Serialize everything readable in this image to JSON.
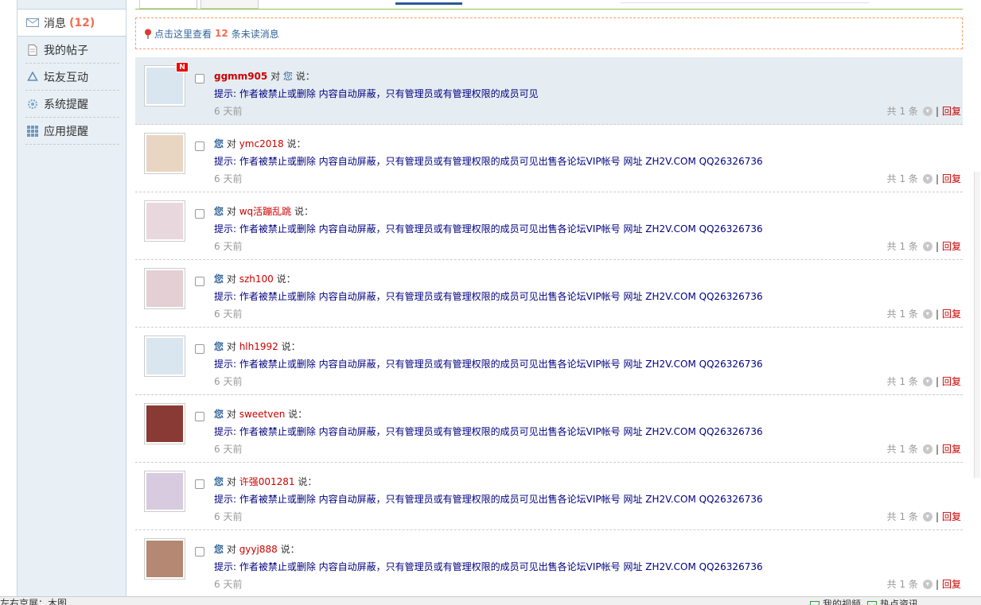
{
  "sidebar": {
    "items": [
      {
        "label": "消息",
        "count": "(12)",
        "icon": "envelope-icon"
      },
      {
        "label": "我的帖子",
        "icon": "document-icon"
      },
      {
        "label": "坛友互动",
        "icon": "recycle-icon"
      },
      {
        "label": "系统提醒",
        "icon": "gear-icon"
      },
      {
        "label": "应用提醒",
        "icon": "grid-icon"
      }
    ]
  },
  "notice": {
    "prefix": "点击这里查看",
    "count": "12",
    "suffix": "条未读消息",
    "icon": "pin-icon"
  },
  "messages": [
    {
      "sender": "ggmm905",
      "mid": "对",
      "target": "您",
      "verb": "说：",
      "content": "提示: 作者被禁止或删除 内容自动屏蔽，只有管理员或有管理权限的成员可见",
      "time": "6 天前",
      "count": "共 1 条",
      "reply": "回复",
      "new_badge": "N",
      "avatar_color": "#d9e6f0"
    },
    {
      "sender": "您",
      "mid": "对",
      "target": "ymc2018",
      "verb": "说：",
      "content": "提示: 作者被禁止或删除 内容自动屏蔽，只有管理员或有管理权限的成员可见出售各论坛VIP帐号 网址 ZH2V.COM QQ26326736",
      "time": "6 天前",
      "count": "共 1 条",
      "reply": "回复",
      "avatar_color": "#e9d6c2"
    },
    {
      "sender": "您",
      "mid": "对",
      "target": "wq活蹦乱跳",
      "verb": "说：",
      "content": "提示: 作者被禁止或删除 内容自动屏蔽，只有管理员或有管理权限的成员可见出售各论坛VIP帐号 网址 ZH2V.COM QQ26326736",
      "time": "6 天前",
      "count": "共 1 条",
      "reply": "回复",
      "avatar_color": "#e8d8de"
    },
    {
      "sender": "您",
      "mid": "对",
      "target": "szh100",
      "verb": "说：",
      "content": "提示: 作者被禁止或删除 内容自动屏蔽，只有管理员或有管理权限的成员可见出售各论坛VIP帐号 网址 ZH2V.COM QQ26326736",
      "time": "6 天前",
      "count": "共 1 条",
      "reply": "回复",
      "avatar_color": "#e3cfd4"
    },
    {
      "sender": "您",
      "mid": "对",
      "target": "hlh1992",
      "verb": "说：",
      "content": "提示: 作者被禁止或删除 内容自动屏蔽，只有管理员或有管理权限的成员可见出售各论坛VIP帐号 网址 ZH2V.COM QQ26326736",
      "time": "6 天前",
      "count": "共 1 条",
      "reply": "回复",
      "avatar_color": "#d9e6f0"
    },
    {
      "sender": "您",
      "mid": "对",
      "target": "sweetven",
      "verb": "说：",
      "content": "提示: 作者被禁止或删除 内容自动屏蔽，只有管理员或有管理权限的成员可见出售各论坛VIP帐号 网址 ZH2V.COM QQ26326736",
      "time": "6 天前",
      "count": "共 1 条",
      "reply": "回复",
      "avatar_color": "#8a3a34"
    },
    {
      "sender": "您",
      "mid": "对",
      "target": "许强001281",
      "verb": "说：",
      "content": "提示: 作者被禁止或删除 内容自动屏蔽，只有管理员或有管理权限的成员可见出售各论坛VIP帐号 网址 ZH2V.COM QQ26326736",
      "time": "6 天前",
      "count": "共 1 条",
      "reply": "回复",
      "avatar_color": "#d8cbe0"
    },
    {
      "sender": "您",
      "mid": "对",
      "target": "gyyj888",
      "verb": "说：",
      "content": "提示: 作者被禁止或删除 内容自动屏蔽，只有管理员或有管理权限的成员可见出售各论坛VIP帐号 网址 ZH2V.COM QQ26326736",
      "time": "6 天前",
      "count": "共 1 条",
      "reply": "回复",
      "avatar_color": "#b48872"
    }
  ],
  "statusbar": {
    "left": "左右京展：木图",
    "right1": "我的视频",
    "right2": "热点资讯"
  }
}
